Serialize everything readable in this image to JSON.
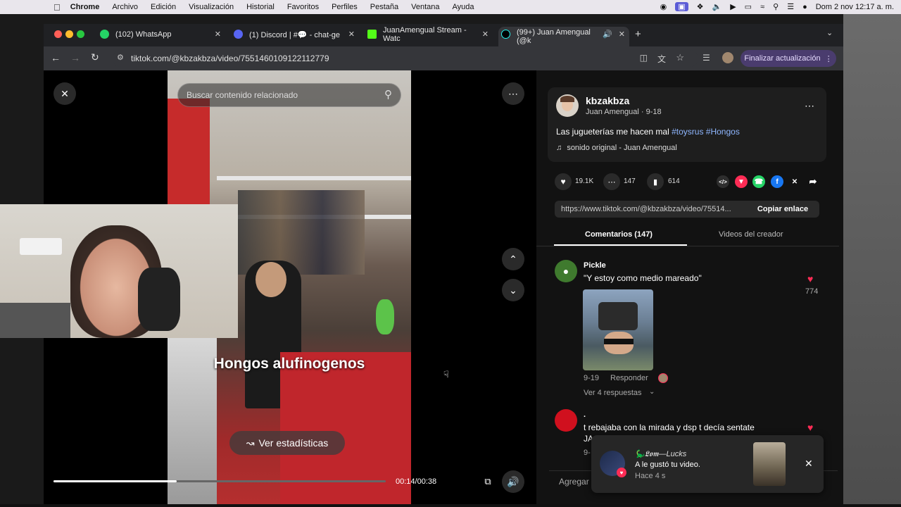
{
  "menubar": {
    "app": "Chrome",
    "items": [
      "Archivo",
      "Edición",
      "Visualización",
      "Historial",
      "Favoritos",
      "Perfiles",
      "Pestaña",
      "Ventana",
      "Ayuda"
    ],
    "clock": "Dom 2 nov  12:17 a. m."
  },
  "tabs": [
    {
      "label": "(102) WhatsApp",
      "color": "#25d366"
    },
    {
      "label": "(1) Discord | #💬 - chat-ge",
      "color": "#5865f2"
    },
    {
      "label": "JuanAmengual Stream - Watc",
      "color": "#53fc18"
    },
    {
      "label": "(99+) Juan Amengual (@k",
      "color": "#000000"
    }
  ],
  "address": {
    "url": "tiktok.com/@kbzakbza/video/7551460109122112779",
    "update_label": "Finalizar actualización"
  },
  "video": {
    "search_placeholder": "Buscar contenido relacionado",
    "overlay_caption": "Hongos alufinogenos",
    "stats_label": "Ver estadísticas",
    "timecode": "00:14/00:38",
    "progress": 0.37
  },
  "author": {
    "username": "kbzakbza",
    "display": "Juan Amengual · 9-18",
    "caption_text": "Las jugueterías me hacen mal ",
    "hashtags": "#toysrus #Hongos",
    "sound": "sonido original - Juan Amengual"
  },
  "actions": {
    "likes": "19.1K",
    "comments": "147",
    "saves": "614"
  },
  "link": {
    "url": "https://www.tiktok.com/@kbzakbza/video/75514...",
    "copy_label": "Copiar enlace"
  },
  "comment_tabs": {
    "comments": "Comentarios (147)",
    "creator_videos": "Videos del creador"
  },
  "comments": [
    {
      "user": "Pickle",
      "text": "\"Y estoy como medio mareado\"",
      "likes": "774",
      "date": "9-19",
      "reply": "Responder",
      "view_replies": "Ver 4 respuestas"
    },
    {
      "user": ".",
      "text": "t rebajaba con la mirada y dsp t decía sentate",
      "text2": "JAJAJAJAJA",
      "date": "9-"
    }
  ],
  "add_comment": "Agregar comentario...",
  "toast": {
    "user": "🦕𝕷𝖔𝖒—Lucks",
    "message": "A le gustó tu video.",
    "time": "Hace 4 s"
  }
}
